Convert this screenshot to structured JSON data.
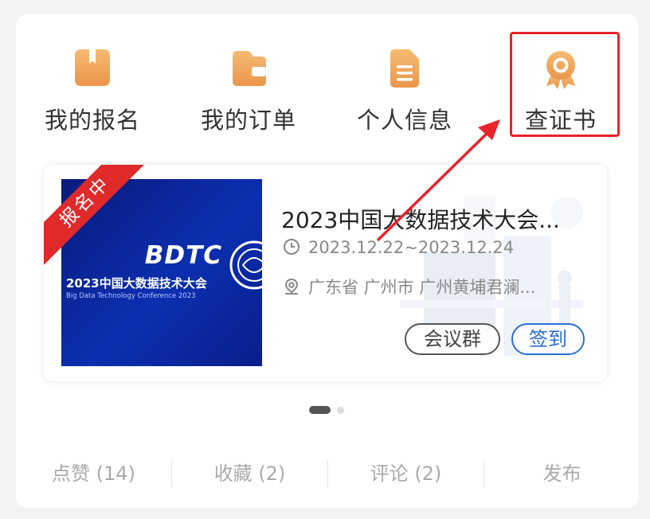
{
  "quick_menu": [
    {
      "label": "我的报名",
      "icon": "bookmark-icon"
    },
    {
      "label": "我的订单",
      "icon": "wallet-icon"
    },
    {
      "label": "个人信息",
      "icon": "document-icon"
    },
    {
      "label": "查证书",
      "icon": "award-icon"
    }
  ],
  "event": {
    "status_ribbon": "报名中",
    "title": "2023中国大数据技术大会...",
    "date": "2023.12.22~2023.12.24",
    "location": "广东省 广州市 广州黄埔君澜...",
    "poster": {
      "logo": "BDTC",
      "title": "2023中国大数据技术大会",
      "subtitle": "Big Data Technology Conference 2023"
    },
    "buttons": {
      "group": "会议群",
      "checkin": "签到"
    }
  },
  "stats": [
    {
      "label": "点赞 (14)"
    },
    {
      "label": "收藏 (2)"
    },
    {
      "label": "评论 (2)"
    },
    {
      "label": "发布"
    }
  ],
  "colors": {
    "icon_orange": "#f0a85a",
    "highlight_red": "#e8232a",
    "checkin_blue": "#2c6fd6",
    "ribbon_red": "#e02a2a"
  }
}
